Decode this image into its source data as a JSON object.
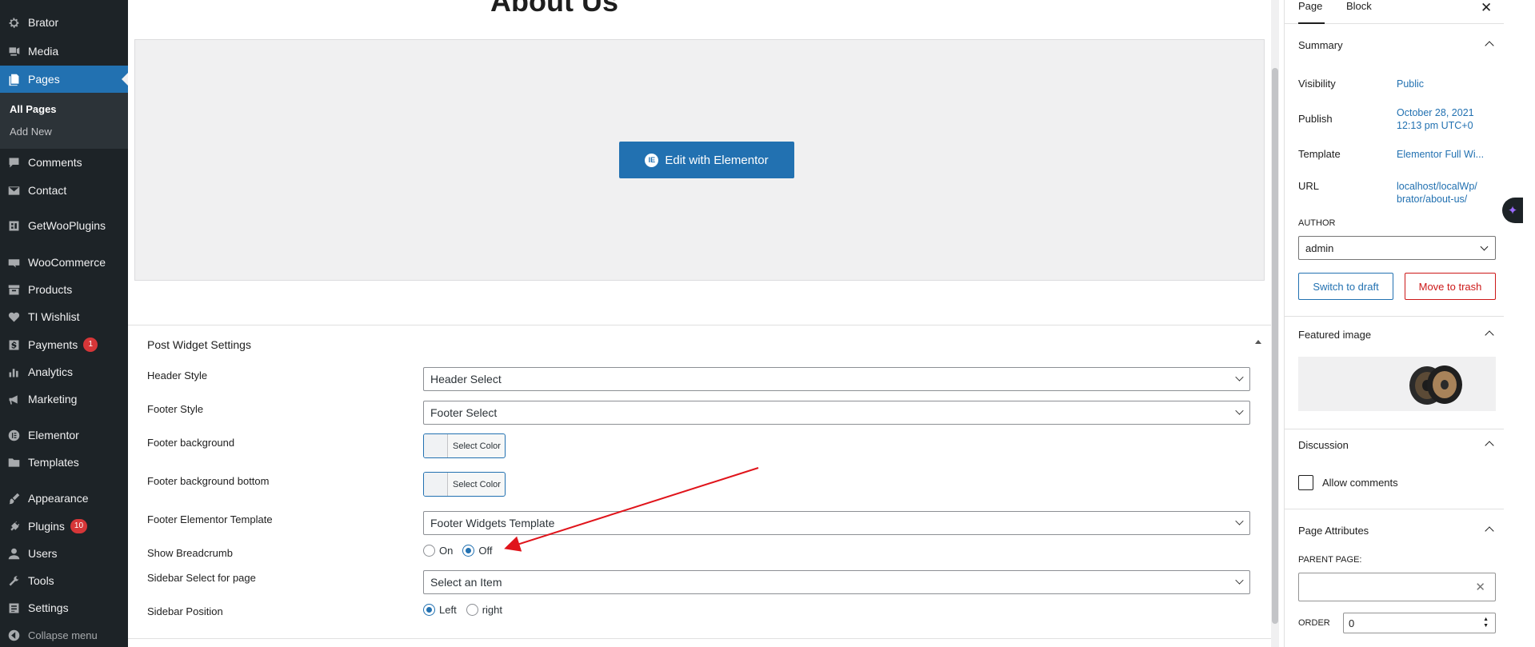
{
  "admin_menu": {
    "items": [
      {
        "label": "Brator",
        "icon": "gear-icon"
      },
      {
        "label": "Media",
        "icon": "media-icon"
      },
      {
        "label": "Pages",
        "icon": "pages-icon"
      },
      {
        "label": "Comments",
        "icon": "comment-icon"
      },
      {
        "label": "Contact",
        "icon": "mail-icon"
      },
      {
        "label": "GetWooPlugins",
        "icon": "plugin-store-icon"
      },
      {
        "label": "WooCommerce",
        "icon": "woo-icon"
      },
      {
        "label": "Products",
        "icon": "archive-icon"
      },
      {
        "label": "TI Wishlist",
        "icon": "heart-icon"
      },
      {
        "label": "Payments",
        "icon": "dollar-icon",
        "badge": "1"
      },
      {
        "label": "Analytics",
        "icon": "bar-chart-icon"
      },
      {
        "label": "Marketing",
        "icon": "megaphone-icon"
      },
      {
        "label": "Elementor",
        "icon": "elementor-icon"
      },
      {
        "label": "Templates",
        "icon": "folder-icon"
      },
      {
        "label": "Appearance",
        "icon": "brush-icon"
      },
      {
        "label": "Plugins",
        "icon": "plug-icon",
        "badge": "10"
      },
      {
        "label": "Users",
        "icon": "user-icon"
      },
      {
        "label": "Tools",
        "icon": "wrench-icon"
      },
      {
        "label": "Settings",
        "icon": "settings-icon"
      }
    ],
    "submenu": {
      "all_pages": "All Pages",
      "add_new": "Add New"
    },
    "collapse": "Collapse menu"
  },
  "editor": {
    "page_title": "About Us",
    "elementor_button": "Edit with Elementor",
    "metabox": {
      "title": "Post Widget Settings",
      "header_style": {
        "label": "Header Style",
        "value": "Header Select"
      },
      "footer_style": {
        "label": "Footer Style",
        "value": "Footer Select"
      },
      "footer_background": {
        "label": "Footer background",
        "button": "Select Color"
      },
      "footer_background_bottom": {
        "label": "Footer background bottom",
        "button": "Select Color"
      },
      "footer_template": {
        "label": "Footer Elementor Template",
        "value": "Footer Widgets Template"
      },
      "show_breadcrumb": {
        "label": "Show Breadcrumb",
        "options": [
          "On",
          "Off"
        ],
        "selected": "Off"
      },
      "sidebar_select": {
        "label": "Sidebar Select for page",
        "value": "Select an Item"
      },
      "sidebar_position": {
        "label": "Sidebar Position",
        "options": [
          "Left",
          "right"
        ],
        "selected": "Left"
      }
    },
    "annotation_color": "#e0141b"
  },
  "settings_sidebar": {
    "tabs": [
      "Page",
      "Block"
    ],
    "active_tab": "Page",
    "summary": {
      "title": "Summary",
      "visibility": {
        "label": "Visibility",
        "value": "Public"
      },
      "publish": {
        "label": "Publish",
        "value_line1": "October 28, 2021",
        "value_line2": "12:13 pm UTC+0"
      },
      "template": {
        "label": "Template",
        "value": "Elementor Full Wi..."
      },
      "url": {
        "label": "URL",
        "value_line1": "localhost/localWp/",
        "value_line2": "brator/about-us/"
      },
      "author_label": "AUTHOR",
      "author_value": "admin",
      "switch_draft": "Switch to draft",
      "move_trash": "Move to trash"
    },
    "featured_image": {
      "title": "Featured image"
    },
    "discussion": {
      "title": "Discussion",
      "allow_comments": "Allow comments"
    },
    "page_attributes": {
      "title": "Page Attributes",
      "parent_label": "PARENT PAGE:",
      "order_label": "ORDER",
      "order_value": "0"
    }
  },
  "colors": {
    "wp_blue": "#2271b1",
    "admin_bg": "#1d2327",
    "danger": "#cc1818",
    "badge": "#d63638"
  }
}
